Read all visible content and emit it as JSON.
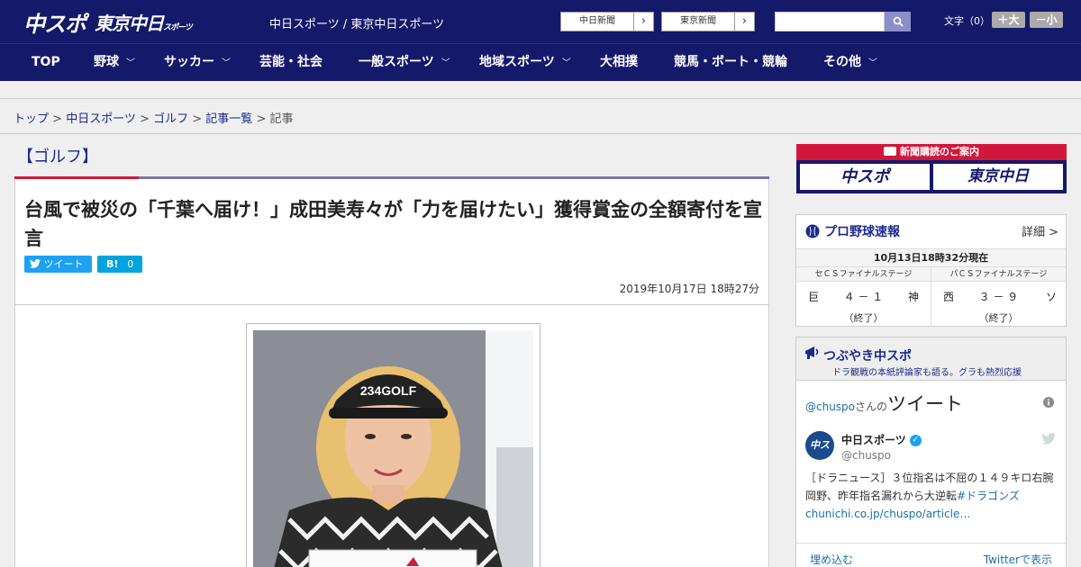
{
  "header": {
    "logo_main": "中スポ",
    "logo_sub": "東京中日",
    "logo_sub_small": "スポーツ",
    "site_title": "中日スポーツ / 東京中日スポーツ",
    "paper_buttons": [
      {
        "label": "中日新聞",
        "arrow": "›"
      },
      {
        "label": "東京新聞",
        "arrow": "›"
      }
    ],
    "search_icon": "search-icon",
    "search_glyph": "🔍",
    "font_size_label": "文字（0）",
    "font_larger": "＋大",
    "font_smaller": "－小"
  },
  "nav": {
    "items": [
      {
        "label": "TOP",
        "has_menu": false
      },
      {
        "label": "野球",
        "has_menu": true
      },
      {
        "label": "サッカー",
        "has_menu": true
      },
      {
        "label": "芸能・社会",
        "has_menu": false
      },
      {
        "label": "一般スポーツ",
        "has_menu": true
      },
      {
        "label": "地域スポーツ",
        "has_menu": true
      },
      {
        "label": "大相撲",
        "has_menu": false
      },
      {
        "label": "競馬・ボート・競輪",
        "has_menu": false
      },
      {
        "label": "その他",
        "has_menu": true
      }
    ],
    "chevron": "﹀"
  },
  "breadcrumb": {
    "items": [
      "トップ",
      "中日スポーツ",
      "ゴルフ",
      "記事一覧"
    ],
    "current": "記事",
    "separator": " > "
  },
  "article": {
    "category": "【ゴルフ】",
    "headline": "台風で被災の「千葉へ届け！」成田美寿々が「力を届けたい」獲得賞金の全額寄付を宣言",
    "tweet_label": "ツイート",
    "hatena_label": "B!",
    "hatena_count": "0",
    "date": "2019年10月17日 18時27分"
  },
  "sidebar": {
    "subscribe": {
      "heading": "新聞購読のご案内",
      "logo_1": "中スポ",
      "logo_2": "東京中日"
    },
    "baseball": {
      "title": "プロ野球速報",
      "more": "詳細 >",
      "time": "10月13日18時32分現在",
      "games": [
        {
          "stage": "セＣＳファイナルステージ",
          "home": "巨",
          "away": "神",
          "score": "４ － １",
          "status": "（終了）"
        },
        {
          "stage": "パＣＳファイナルステージ",
          "home": "西",
          "away": "ソ",
          "score": "３ － ９",
          "status": "（終了）"
        }
      ]
    },
    "tweets": {
      "title": "つぶやき中スポ",
      "subtitle": "ドラ観戦の本紙評論家も語る。グラも熱烈応援",
      "handle": "@chuspo",
      "handle_suffix": "さんの",
      "heading": "ツイート",
      "author_name": "中日スポーツ",
      "author_user": "@chuspo",
      "avatar_text": "中スポ",
      "body_text": "［ドラニュース］３位指名は不屈の１４９キロ右腕　岡野、昨年指名漏れから大逆転",
      "body_tag": "#ドラゴンズ",
      "body_link": "chunichi.co.jp/chuspo/article…",
      "embed": "埋め込む",
      "view_on": "Twitterで表示"
    }
  },
  "colors": {
    "brand_navy": "#14196a",
    "accent_red": "#d1183a",
    "link_blue": "#1c2a8c",
    "twitter_blue": "#1da1f2"
  }
}
